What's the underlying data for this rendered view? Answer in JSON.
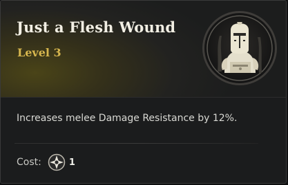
{
  "ability": {
    "title": "Just a Flesh Wound",
    "level": "Level 3",
    "icon": "armored-knight-icon",
    "description": "Increases melee Damage Resistance by 12%.",
    "cost_label": "Cost:",
    "cost_icon": "skill-point-icon",
    "cost_value": "1"
  },
  "colors": {
    "title": "#f2efe4",
    "level": "#d6b64e",
    "header_glow": "#4a4418",
    "background": "#1b1c1d"
  }
}
